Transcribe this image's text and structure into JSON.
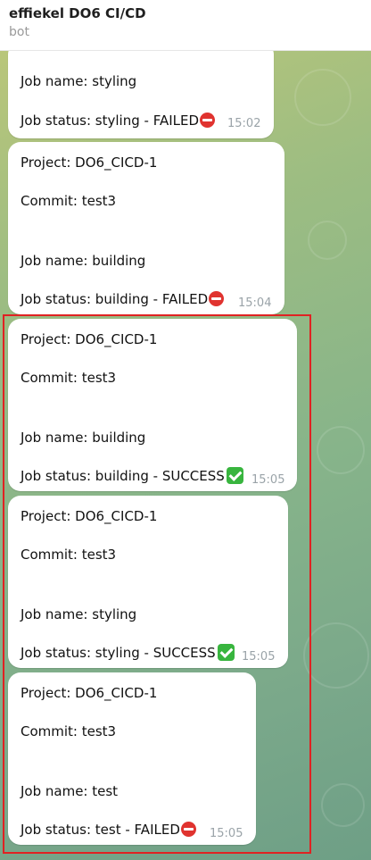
{
  "header": {
    "title": "effiekel DO6 CI/CD",
    "subtitle": "bot"
  },
  "messages": [
    {
      "job_name": "Job name: styling",
      "status_text": "Job status: styling - FAILED",
      "status_icon": "failed-icon",
      "time": "15:02"
    },
    {
      "project": "Project: DO6_CICD-1",
      "commit": "Commit: test3",
      "job_name": "Job name: building",
      "status_text": "Job status: building - FAILED",
      "status_icon": "failed-icon",
      "time": "15:04"
    },
    {
      "project": "Project: DO6_CICD-1",
      "commit": "Commit: test3",
      "job_name": "Job name: building",
      "status_text": "Job status: building - SUCCESS",
      "status_icon": "success-icon",
      "time": "15:05"
    },
    {
      "project": "Project: DO6_CICD-1",
      "commit": "Commit: test3",
      "job_name": "Job name: styling",
      "status_text": "Job status: styling - SUCCESS",
      "status_icon": "success-icon",
      "time": "15:05"
    },
    {
      "project": "Project: DO6_CICD-1",
      "commit": "Commit: test3",
      "job_name": "Job name: test",
      "status_text": "Job status: test - FAILED",
      "status_icon": "failed-icon",
      "time": "15:05"
    }
  ],
  "colors": {
    "highlight": "#e02222",
    "failed": "#e0332f",
    "success": "#38b53e"
  }
}
